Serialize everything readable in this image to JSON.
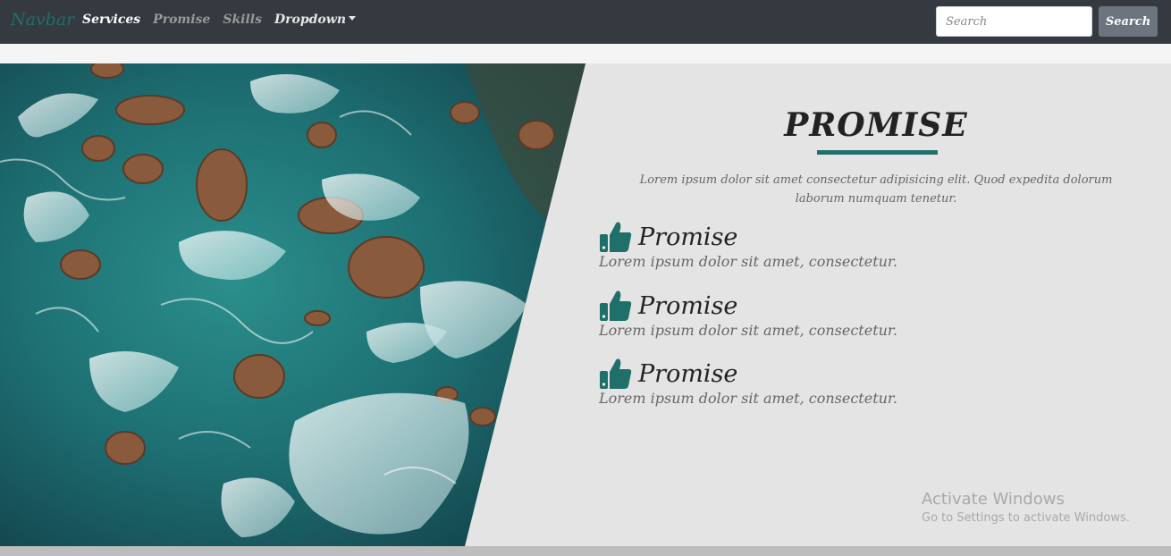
{
  "navbar": {
    "brand": "Navbar",
    "links": [
      {
        "label": "Services"
      },
      {
        "label": "Promise"
      },
      {
        "label": "Skills"
      },
      {
        "label": "Dropdown"
      }
    ],
    "search_placeholder": "Search",
    "search_button": "Search"
  },
  "section": {
    "title": "PROMISE",
    "intro": "Lorem ipsum dolor sit amet consectetur adipisicing elit. Quod expedita dolorum laborum numquam tenetur.",
    "items": [
      {
        "icon": "thumbs-up-icon",
        "title": "Promise",
        "desc": "Lorem ipsum dolor sit amet, consectetur."
      },
      {
        "icon": "thumbs-up-icon",
        "title": "Promise",
        "desc": "Lorem ipsum dolor sit amet, consectetur."
      },
      {
        "icon": "thumbs-up-icon",
        "title": "Promise",
        "desc": "Lorem ipsum dolor sit amet, consectetur."
      }
    ]
  },
  "watermark": {
    "title": "Activate Windows",
    "subtitle": "Go to Settings to activate Windows."
  },
  "colors": {
    "navbar_bg": "#343a40",
    "accent": "#1f6f6a",
    "section_bg": "#e4e4e4",
    "button_bg": "#6c757d"
  }
}
